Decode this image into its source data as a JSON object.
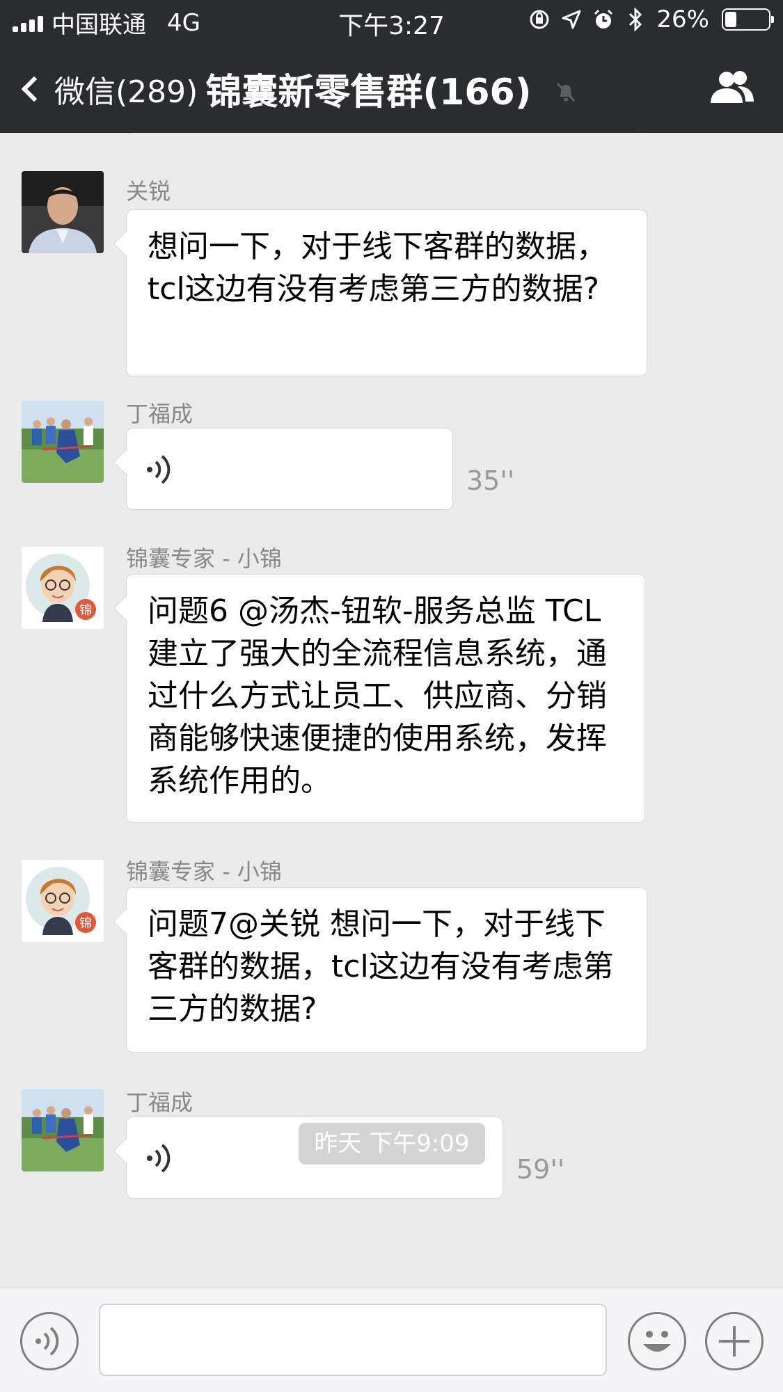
{
  "status_bar": {
    "carrier": "中国联通",
    "network": "4G",
    "time": "下午3:27",
    "battery": "26%",
    "battery_level": 0.26
  },
  "nav": {
    "back_label": "微信(289)",
    "title": "锦囊新零售群(166)"
  },
  "messages": [
    {
      "sender": "关锐",
      "type": "text",
      "text": "想问一下，对于线下客群的数据，tcl这边有没有考虑第三方的数据?"
    },
    {
      "sender": "丁福成",
      "type": "voice",
      "duration": "35''"
    },
    {
      "sender": "锦囊专家 - 小锦",
      "type": "text",
      "text": "问题6 @汤杰-钮软-服务总监 TCL建立了强大的全流程信息系统，通过什么方式让员工、供应商、分销商能够快速便捷的使用系统，发挥系统作用的。"
    },
    {
      "sender": "锦囊专家 - 小锦",
      "type": "text",
      "text": "问题7@关锐  想问一下，对于线下客群的数据，tcl这边有没有考虑第三方的数据?"
    },
    {
      "sender": "丁福成",
      "type": "voice",
      "duration": "59''"
    }
  ],
  "timestamp": "昨天 下午9:09",
  "input_bar": {
    "voice_icon": "voice-icon",
    "emoji_icon": "emoji-icon",
    "plus_icon": "plus-icon"
  }
}
